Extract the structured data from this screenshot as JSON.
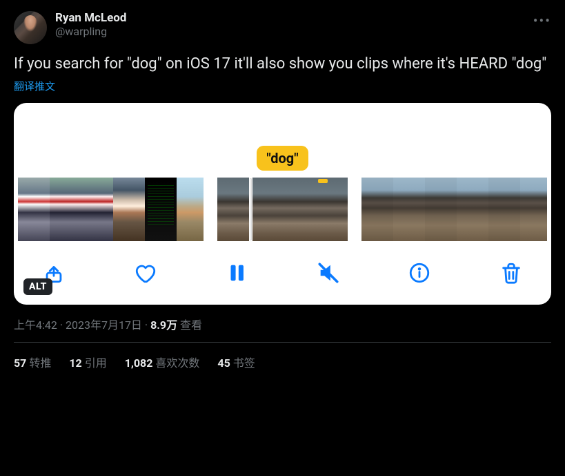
{
  "author": {
    "display_name": "Ryan McLeod",
    "handle": "@warpling"
  },
  "body_text": "If you search for \"dog\" on iOS 17 it'll also show you clips where it's HEARD \"dog\"",
  "translate_label": "翻译推文",
  "media": {
    "chip_label": "\"dog\"",
    "alt_badge": "ALT"
  },
  "meta": {
    "time": "上午4:42",
    "sep1": " · ",
    "date": "2023年7月17日",
    "sep2": " · ",
    "views_count": "8.9万",
    "views_label": " 查看"
  },
  "stats": {
    "retweets_n": "57",
    "retweets_label": "转推",
    "quotes_n": "12",
    "quotes_label": "引用",
    "likes_n": "1,082",
    "likes_label": "喜欢次数",
    "bookmarks_n": "45",
    "bookmarks_label": "书签"
  }
}
